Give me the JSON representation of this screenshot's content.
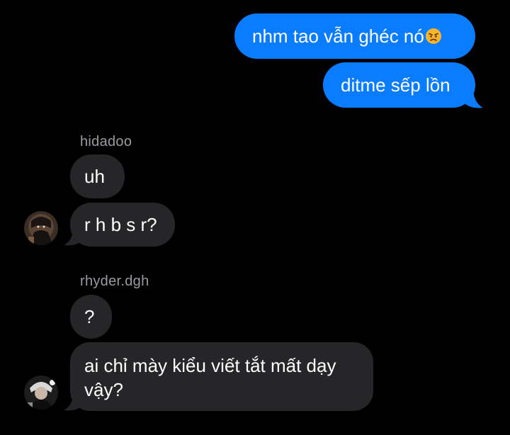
{
  "outgoing": [
    {
      "text": "nhm tao vẫn ghéc nó",
      "emoji": "angry-face-icon"
    },
    {
      "text": "ditme sếp lồn"
    }
  ],
  "groups": [
    {
      "sender": "hidadoo",
      "avatar": "avatar-hidadoo",
      "messages": [
        "uh",
        "r h b s r?"
      ]
    },
    {
      "sender": "rhyder.dgh",
      "avatar": "avatar-rhyder",
      "messages": [
        "?",
        "ai chỉ mày kiểu viết tắt mất dạy",
        "vậy?"
      ]
    }
  ],
  "colors": {
    "background": "#000000",
    "outgoing_bubble": "#0a7cff",
    "incoming_bubble": "#262629",
    "sender_name": "#9a9aa0",
    "text": "#ffffff"
  }
}
